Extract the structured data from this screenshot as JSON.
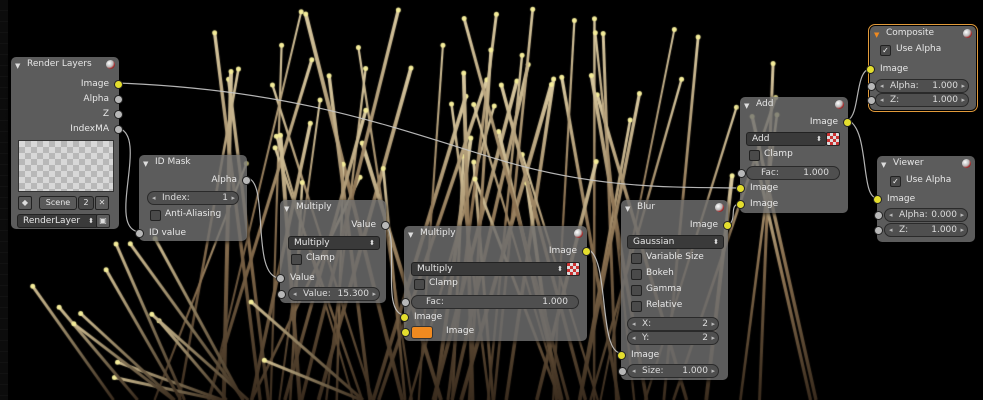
{
  "nodes": {
    "render_layers": {
      "title": "Render Layers",
      "outputs": [
        "Image",
        "Alpha",
        "Z",
        "IndexMA"
      ],
      "scene_label": "Scene",
      "scene_users": "2",
      "layer": "RenderLayer"
    },
    "id_mask": {
      "title": "ID Mask",
      "output": "Alpha",
      "index_label": "Index:",
      "index_value": "1",
      "anti_aliasing": "Anti-Aliasing",
      "input": "ID value"
    },
    "multiply_value": {
      "title": "Multiply",
      "output": "Value",
      "operation": "Multiply",
      "clamp": "Clamp",
      "input1": "Value",
      "value_label": "Value:",
      "value": "15.300"
    },
    "multiply_mix": {
      "title": "Multiply",
      "output": "Image",
      "blend": "Multiply",
      "clamp": "Clamp",
      "fac_label": "Fac:",
      "fac_value": "1.000",
      "input1": "Image",
      "input2": "Image",
      "color2": "#f08a20"
    },
    "blur": {
      "title": "Blur",
      "output": "Image",
      "filter": "Gaussian",
      "variable_size": "Variable Size",
      "bokeh": "Bokeh",
      "gamma": "Gamma",
      "relative": "Relative",
      "x_label": "X:",
      "x_value": "2",
      "y_label": "Y:",
      "y_value": "2",
      "input": "Image",
      "size_label": "Size:",
      "size_value": "1.000"
    },
    "add": {
      "title": "Add",
      "output": "Image",
      "blend": "Add",
      "clamp": "Clamp",
      "fac_label": "Fac:",
      "fac_value": "1.000",
      "input1": "Image",
      "input2": "Image"
    },
    "composite": {
      "title": "Composite",
      "use_alpha": "Use Alpha",
      "input": "Image",
      "alpha_label": "Alpha:",
      "alpha_value": "1.000",
      "z_label": "Z:",
      "z_value": "1.000"
    },
    "viewer": {
      "title": "Viewer",
      "use_alpha": "Use Alpha",
      "input": "Image",
      "alpha_label": "Alpha:",
      "alpha_value": "0.000",
      "z_label": "Z:",
      "z_value": "1.000"
    }
  },
  "colors": {
    "socket_color": "#e4de2e",
    "socket_value": "#b8b8b8",
    "selected_outline": "#e19a3a",
    "node_body": "#707070",
    "background": "#000000"
  }
}
